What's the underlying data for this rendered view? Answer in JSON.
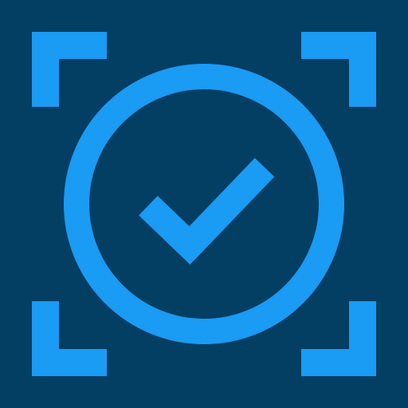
{
  "icon": {
    "name": "scan-verified-icon",
    "background_color": "#033E63",
    "accent_color": "#1A9BF4",
    "parts": {
      "corners": [
        "top-left",
        "top-right",
        "bottom-left",
        "bottom-right"
      ],
      "center": "check-circle"
    }
  }
}
